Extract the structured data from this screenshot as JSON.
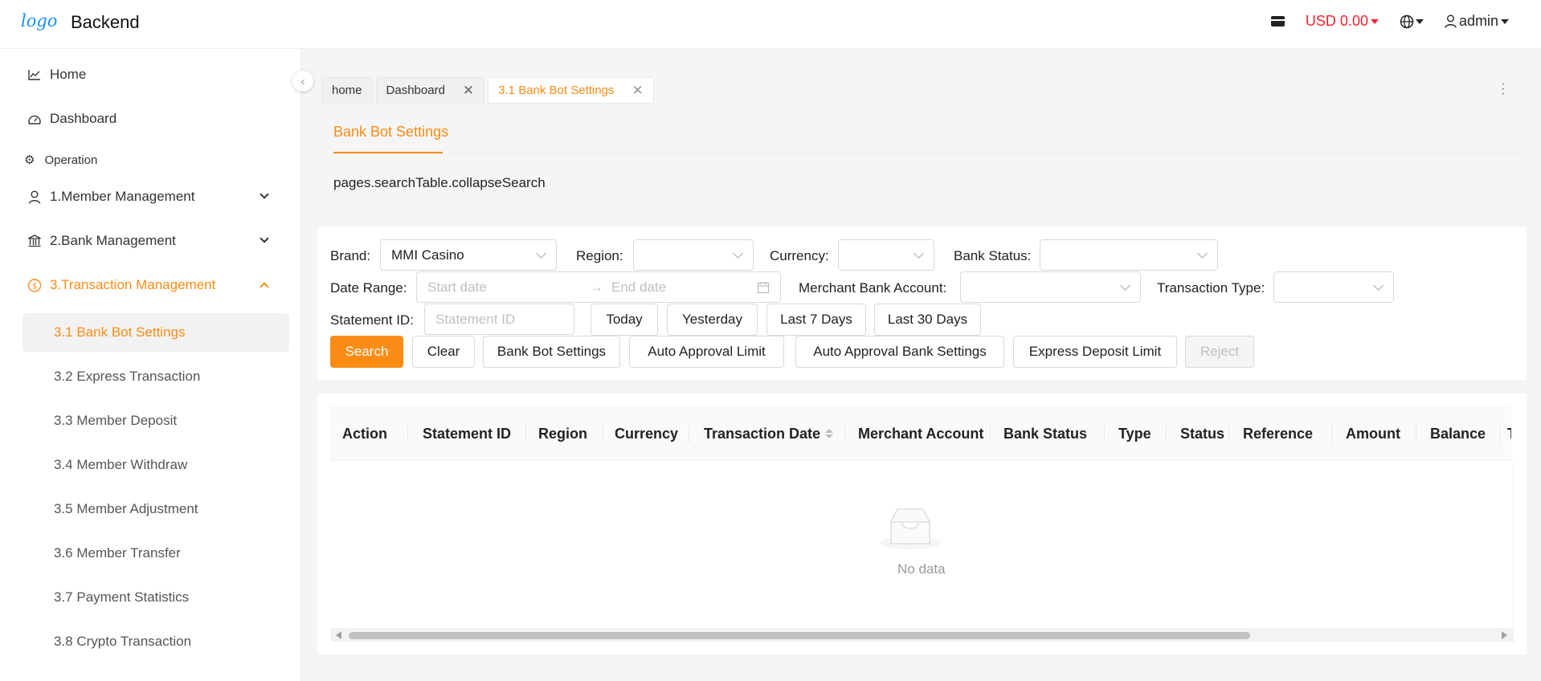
{
  "header": {
    "logo": "logo",
    "title": "Backend",
    "balance": "USD 0.00",
    "user": "admin"
  },
  "sidebar": {
    "items": [
      {
        "label": "Home",
        "icon": "line-chart-icon"
      },
      {
        "label": "Dashboard",
        "icon": "dashboard-icon"
      }
    ],
    "group_label": "Operation",
    "menus": [
      {
        "label": "1.Member Management",
        "icon": "user-icon"
      },
      {
        "label": "2.Bank Management",
        "icon": "bank-icon"
      },
      {
        "label": "3.Transaction Management",
        "icon": "transaction-icon"
      }
    ],
    "sub_items": [
      "3.1 Bank Bot Settings",
      "3.2 Express Transaction",
      "3.3 Member Deposit",
      "3.4 Member Withdraw",
      "3.5 Member Adjustment",
      "3.6 Member Transfer",
      "3.7 Payment Statistics",
      "3.8 Crypto Transaction"
    ]
  },
  "tabs": [
    "home",
    "Dashboard",
    "3.1 Bank Bot Settings"
  ],
  "page": {
    "tab": "Bank Bot Settings",
    "collapse_search": "pages.searchTable.collapseSearch"
  },
  "search": {
    "brand_label": "Brand",
    "brand_value": "MMI Casino",
    "region_label": "Region",
    "currency_label": "Currency",
    "bank_status_label": "Bank Status",
    "date_range_label": "Date Range",
    "start_placeholder": "Start date",
    "end_placeholder": "End date",
    "merchant_label": "Merchant Bank Account",
    "txn_type_label": "Transaction Type",
    "statement_label": "Statement ID",
    "statement_placeholder": "Statement ID",
    "quick": [
      "Today",
      "Yesterday",
      "Last 7 Days",
      "Last 30 Days"
    ],
    "actions": [
      "Search",
      "Clear",
      "Bank Bot Settings",
      "Auto Approval Limit",
      "Auto Approval Bank Settings",
      "Express Deposit Limit",
      "Reject"
    ]
  },
  "table": {
    "columns": [
      "Action",
      "Statement ID",
      "Region",
      "Currency",
      "Transaction Date",
      "Merchant Account",
      "Bank Status",
      "Type",
      "Status",
      "Reference",
      "Amount",
      "Balance",
      "T"
    ],
    "empty": "No data"
  },
  "colors": {
    "accent": "#fa8c16",
    "balance": "#f5222d",
    "link": "#1890ff"
  }
}
